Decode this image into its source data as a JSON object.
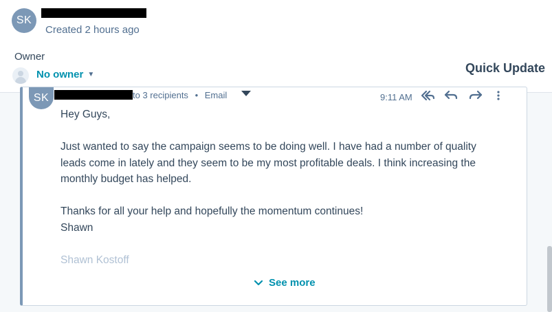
{
  "record": {
    "initials": "SK",
    "created": "Created 2 hours ago"
  },
  "owner": {
    "label": "Owner",
    "value": "No owner"
  },
  "quick_update": "Quick Update",
  "email": {
    "sender_initials": "SK",
    "recipients": "to 3 recipients",
    "separator": "•",
    "type": "Email",
    "time": "9:11 AM",
    "body": [
      "Hey Guys,",
      "Just wanted to say the campaign seems to be doing well.  I have had a number of quality leads come in lately and they seem to be my most profitable deals.  I think increasing the monthly budget has helped.",
      "Thanks for all your help and hopefully the momentum continues!",
      "Shawn",
      "Shawn Kostoff"
    ],
    "see_more": "See more"
  },
  "colors": {
    "accent": "#0091ae",
    "avatar": "#7c98b6",
    "text": "#33475b",
    "muted": "#516f90"
  }
}
